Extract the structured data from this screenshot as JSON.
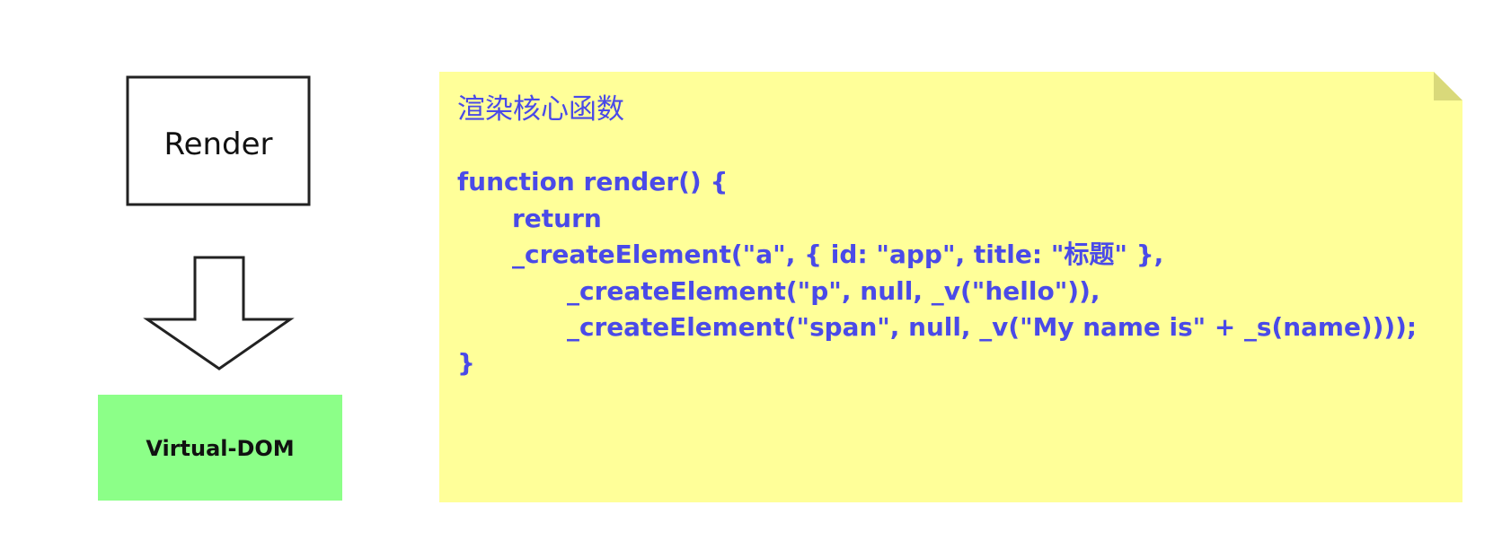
{
  "flow": {
    "render_label": "Render",
    "vdom_label": "Virtual-DOM"
  },
  "note": {
    "title": "渲染核心函数",
    "code_lines": [
      "function render() {",
      "return",
      "_createElement(\"a\", { id: \"app\", title: \"标题\" },",
      "_createElement(\"p\", null, _v(\"hello\")),",
      "_createElement(\"span\", null, _v(\"My name is\" + _s(name))));",
      "}"
    ]
  },
  "colors": {
    "note_fill": "#ffff99",
    "note_fold": "#d9d97a",
    "code_text": "#4a4ae8",
    "vdom_fill": "#8cff88",
    "stroke": "#222222"
  }
}
